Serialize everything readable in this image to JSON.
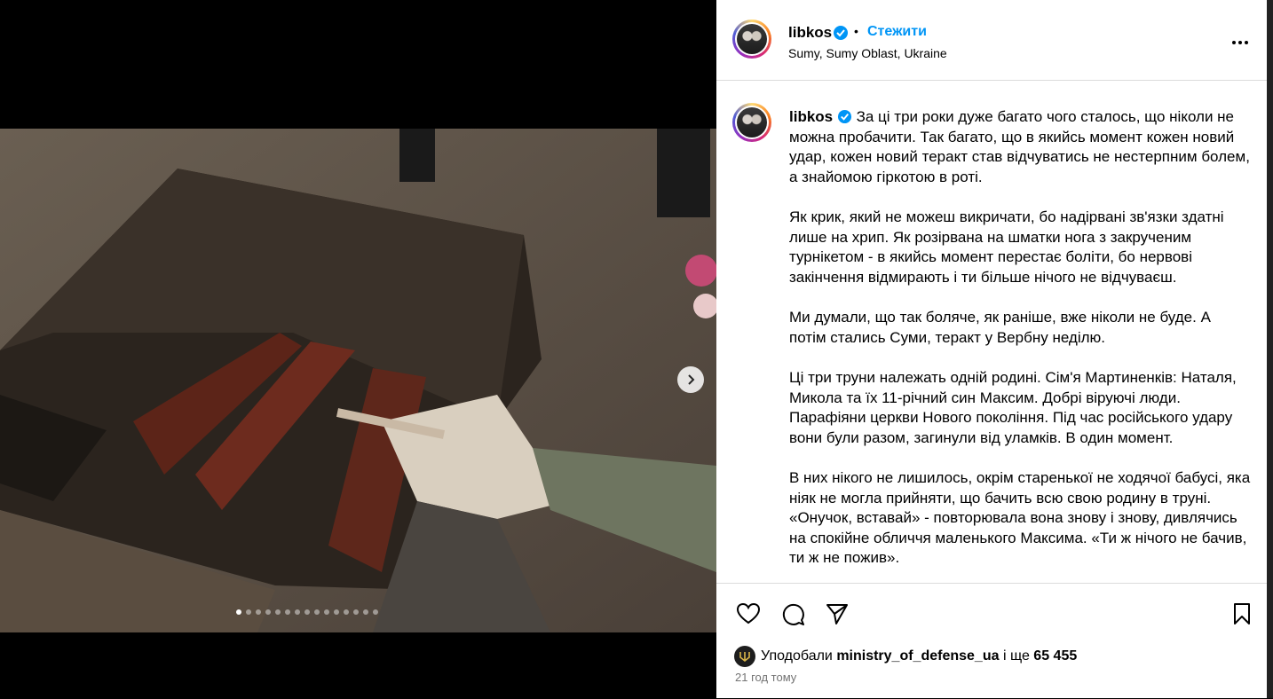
{
  "post": {
    "username": "libkos",
    "follow_label": "Стежити",
    "bullet": "•",
    "location": "Sumy, Sumy Oblast, Ukraine"
  },
  "caption": {
    "username": "libkos",
    "paragraphs": [
      "За ці три роки дуже багато чого сталось, що ніколи не можна пробачити. Так багато, що в якийсь момент кожен новий удар, кожен новий теракт став відчуватись не нестерпним болем, а знайомою гіркотою в роті.",
      "Як крик, який не можеш викричати, бо надірвані зв'язки здатні лише на хрип. Як розірвана на шматки нога з закрученим турнікетом - в якийсь момент перестає боліти, бо нервові закінчення відмирають і ти більше нічого не відчуваєш.",
      "Ми думали, що так боляче, як раніше, вже ніколи не буде. А потім стались Суми, теракт у Вербну неділю.",
      "Ці три труни належать одній родині. Сім'я Мартиненків: Наталя, Микола та їх 11-річний син Максим. Добрі віруючі люди. Парафіяни церкви Нового покоління. Під час російського удару вони були разом, загинули від уламків. В один момент.",
      "В них нікого не лишилось, окрім старенької не ходячої бабусі, яка ніяк не могла прийняти, що бачить всю свою родину в труні. «Онучок, вставай» - повторювала вона знову і знову, дивлячись на спокійне обличчя маленького Максима. «Ти ж нічого не бачив, ти ж не пожив»."
    ]
  },
  "likes": {
    "prefix": "Уподобали",
    "user": "ministry_of_defense_ua",
    "middle": "і ще",
    "count": "65 455"
  },
  "timestamp": "21 год тому",
  "carousel": {
    "total": 15,
    "active_index": 0
  },
  "colors": {
    "accent": "#0095f6",
    "verified": "#0095f6",
    "muted": "#737373"
  },
  "icons": [
    "more-icon",
    "heart-icon",
    "comment-icon",
    "share-icon",
    "bookmark-icon",
    "chevron-right-icon",
    "verified-icon"
  ]
}
